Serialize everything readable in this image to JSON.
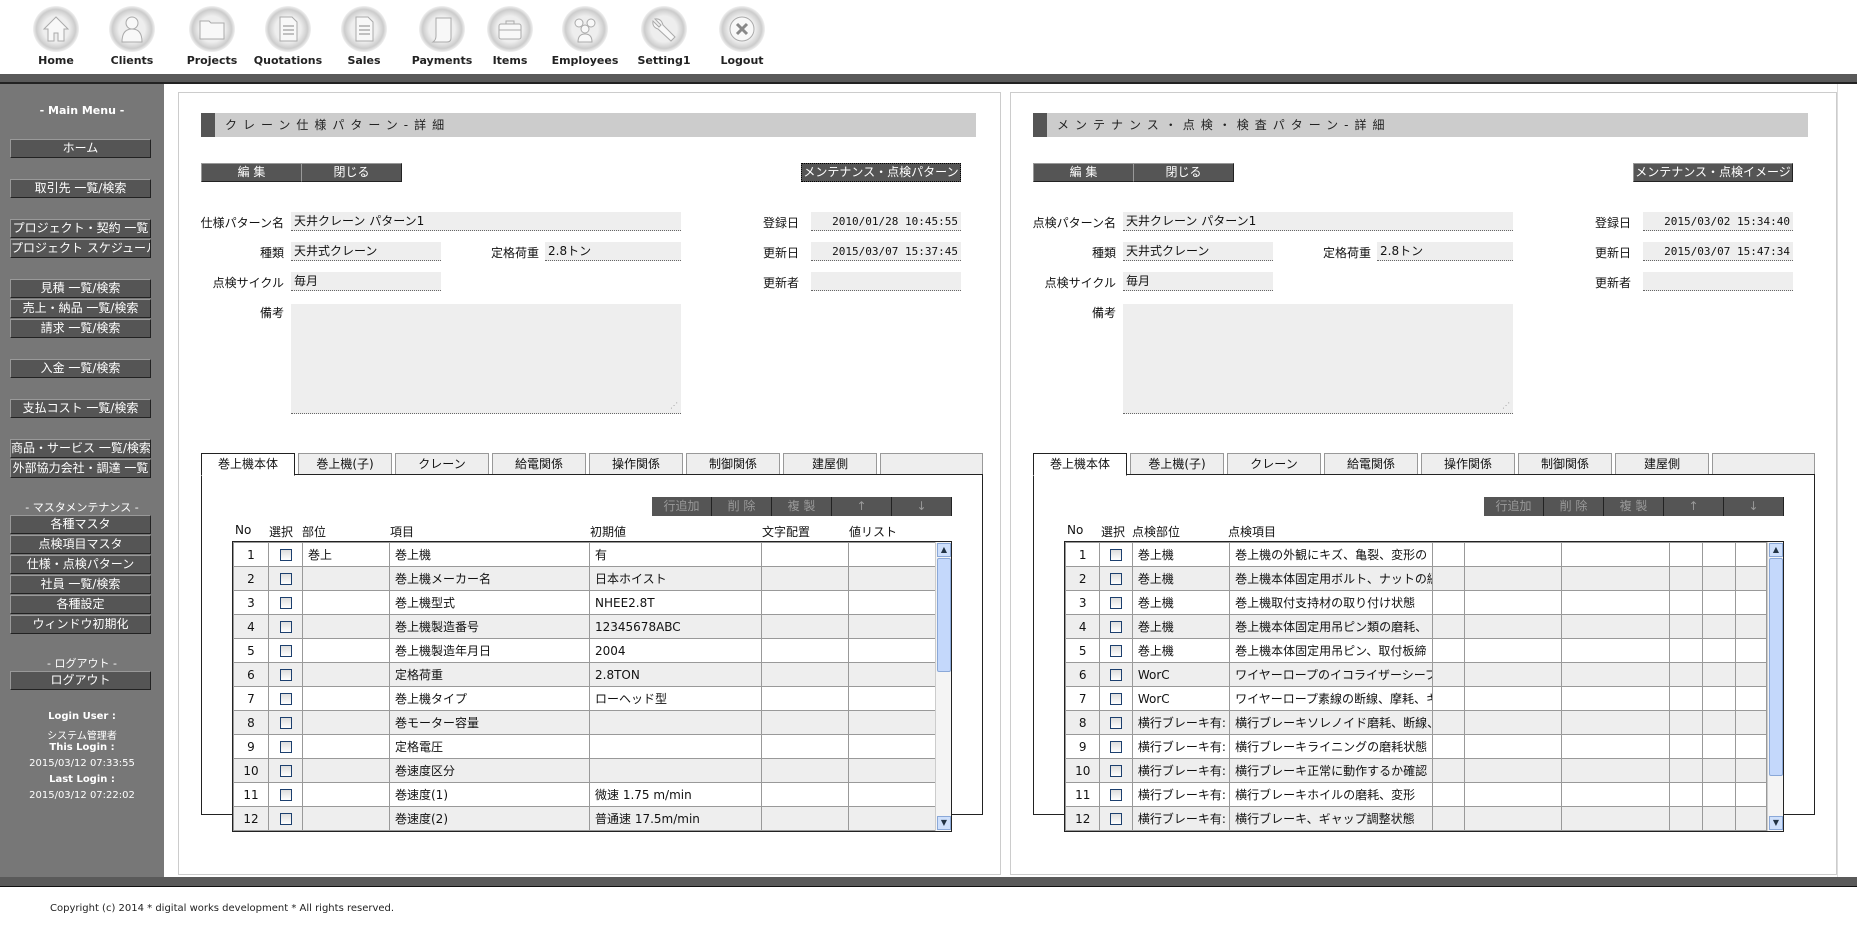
{
  "nav": [
    {
      "label": "Home",
      "icon": "home-icon"
    },
    {
      "label": "Clients",
      "icon": "user-icon"
    },
    {
      "label": "Projects",
      "icon": "folder-icon"
    },
    {
      "label": "Quotations",
      "icon": "document-icon"
    },
    {
      "label": "Sales",
      "icon": "document-icon"
    },
    {
      "label": "Payments",
      "icon": "scroll-icon"
    },
    {
      "label": "Items",
      "icon": "briefcase-icon"
    },
    {
      "label": "Employees",
      "icon": "group-icon"
    },
    {
      "label": "Setting1",
      "icon": "wrench-icon"
    },
    {
      "label": "Logout",
      "icon": "close-circle-icon"
    }
  ],
  "sidebar": {
    "main_menu_heading": "- Main Menu -",
    "items": [
      "ホーム",
      "取引先 一覧/検索",
      "プロジェクト・契約 一覧",
      "プロジェクト スケジュール",
      "見積 一覧/検索",
      "売上・納品 一覧/検索",
      "請求 一覧/検索",
      "入金 一覧/検索",
      "支払コスト 一覧/検索",
      "商品・サービス 一覧/検索",
      "外部協力会社・調達 一覧"
    ],
    "master_heading": "- マスタメンテナンス -",
    "master_items": [
      "各種マスタ",
      "点検項目マスタ",
      "仕様・点検パターン",
      "社員 一覧/検索",
      "各種設定",
      "ウィンドウ初期化"
    ],
    "logout_heading": "- ログアウト -",
    "logout_label": "ログアウト",
    "login_user_label": "Login User :",
    "login_user": "システム管理者",
    "this_login_label": "This Login :",
    "this_login": "2015/03/12 07:33:55",
    "last_login_label": "Last Login :",
    "last_login": "2015/03/12 07:22:02"
  },
  "left": {
    "title": "クレーン仕様パターン-詳細",
    "edit_label": "編 集",
    "close_label": "閉じる",
    "link_label": "メンテナンス・点検パターン",
    "name_label": "仕様パターン名",
    "name_value": "天井クレーン パターン1",
    "type_label": "種類",
    "type_value": "天井式クレーン",
    "load_label": "定格荷重",
    "load_value": "2.8トン",
    "cycle_label": "点検サイクル",
    "cycle_value": "毎月",
    "note_label": "備考",
    "note_value": "",
    "reg_label": "登録日",
    "reg_value": "2010/01/28 10:45:55",
    "upd_label": "更新日",
    "upd_value": "2015/03/07 15:37:45",
    "updater_label": "更新者",
    "updater_value": "",
    "tabs": [
      "巻上機本体",
      "巻上機(子)",
      "クレーン",
      "給電関係",
      "操作関係",
      "制御関係",
      "建屋側",
      ""
    ],
    "row_buttons": [
      "行追加",
      "削 除",
      "複 製",
      "↑",
      "↓"
    ],
    "columns": [
      "No",
      "選択",
      "部位",
      "項目",
      "初期値",
      "文字配置",
      "値リスト"
    ],
    "rows": [
      {
        "no": "1",
        "part": "巻上",
        "item": "巻上機",
        "init": "有"
      },
      {
        "no": "2",
        "part": "",
        "item": "巻上機メーカー名",
        "init": "日本ホイスト"
      },
      {
        "no": "3",
        "part": "",
        "item": "巻上機型式",
        "init": "NHEE2.8T"
      },
      {
        "no": "4",
        "part": "",
        "item": "巻上機製造番号",
        "init": "12345678ABC"
      },
      {
        "no": "5",
        "part": "",
        "item": "巻上機製造年月日",
        "init": "2004"
      },
      {
        "no": "6",
        "part": "",
        "item": "定格荷重",
        "init": "2.8TON"
      },
      {
        "no": "7",
        "part": "",
        "item": "巻上機タイプ",
        "init": "ローヘッド型"
      },
      {
        "no": "8",
        "part": "",
        "item": "巻モーター容量",
        "init": ""
      },
      {
        "no": "9",
        "part": "",
        "item": "定格電圧",
        "init": ""
      },
      {
        "no": "10",
        "part": "",
        "item": "巻速度区分",
        "init": ""
      },
      {
        "no": "11",
        "part": "",
        "item": "巻速度(1)",
        "init": "微速 1.75 m/min"
      },
      {
        "no": "12",
        "part": "",
        "item": "巻速度(2)",
        "init": "普通速 17.5m/min"
      }
    ]
  },
  "right": {
    "title": "メンテナンス・点検・検査パターン-詳細",
    "edit_label": "編 集",
    "close_label": "閉じる",
    "link_label": "メンテナンス・点検イメージ",
    "name_label": "点検パターン名",
    "name_value": "天井クレーン パターン1",
    "type_label": "種類",
    "type_value": "天井式クレーン",
    "load_label": "定格荷重",
    "load_value": "2.8トン",
    "cycle_label": "点検サイクル",
    "cycle_value": "毎月",
    "note_label": "備考",
    "note_value": "",
    "reg_label": "登録日",
    "reg_value": "2015/03/02 15:34:40",
    "upd_label": "更新日",
    "upd_value": "2015/03/07 15:47:34",
    "updater_label": "更新者",
    "updater_value": "",
    "tabs": [
      "巻上機本体",
      "巻上機(子)",
      "クレーン",
      "給電関係",
      "操作関係",
      "制御関係",
      "建屋側",
      ""
    ],
    "row_buttons": [
      "行追加",
      "削 除",
      "複 製",
      "↑",
      "↓"
    ],
    "columns": [
      "No",
      "選択",
      "点検部位",
      "点検項目"
    ],
    "rows": [
      {
        "no": "1",
        "part": "巻上機",
        "item": "巻上機の外観にキズ、亀裂、変形の"
      },
      {
        "no": "2",
        "part": "巻上機",
        "item": "巻上機本体固定用ボルト、ナットの緩"
      },
      {
        "no": "3",
        "part": "巻上機",
        "item": "巻上機取付支持材の取り付け状態"
      },
      {
        "no": "4",
        "part": "巻上機",
        "item": "巻上機本体固定用吊ピン類の磨耗、"
      },
      {
        "no": "5",
        "part": "巻上機",
        "item": "巻上機本体固定用吊ピン、取付板締"
      },
      {
        "no": "6",
        "part": "WorC",
        "item": "ワイヤーロープのイコライザーシーブ"
      },
      {
        "no": "7",
        "part": "WorC",
        "item": "ワイヤーロープ素線の断線、摩耗、キ"
      },
      {
        "no": "8",
        "part": "横行ブレーキ有:",
        "item": "横行ブレーキソレノイド磨耗、断線、排"
      },
      {
        "no": "9",
        "part": "横行ブレーキ有:",
        "item": "横行ブレーキライニングの磨耗状態"
      },
      {
        "no": "10",
        "part": "横行ブレーキ有:",
        "item": "横行ブレーキ正常に動作するか確認"
      },
      {
        "no": "11",
        "part": "横行ブレーキ有:",
        "item": "横行ブレーキホイルの磨耗、変形"
      },
      {
        "no": "12",
        "part": "横行ブレーキ有:",
        "item": "横行ブレーキ、ギャップ調整状態"
      }
    ]
  },
  "footer": {
    "copyright": "Copyright (c) 2014 * digital works development * All rights reserved."
  }
}
